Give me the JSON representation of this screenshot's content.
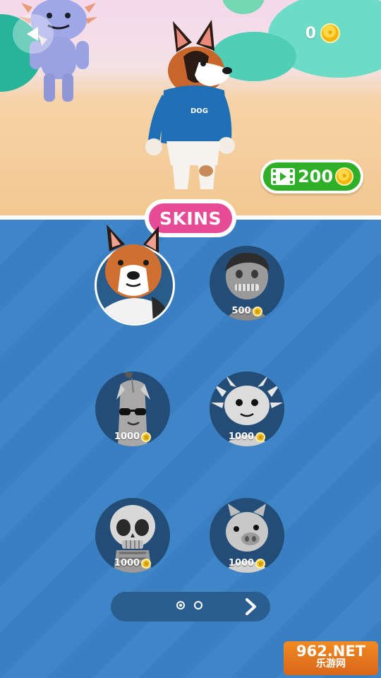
{
  "hud": {
    "coin_total": "0",
    "reward_amount": "200"
  },
  "panel": {
    "title": "SKINS"
  },
  "skins": [
    {
      "name": "dog",
      "price": null,
      "selected": true
    },
    {
      "name": "zombie-boy",
      "price": "500"
    },
    {
      "name": "banana",
      "price": "1000"
    },
    {
      "name": "axolotl",
      "price": "1000"
    },
    {
      "name": "skeleton",
      "price": "1000"
    },
    {
      "name": "pig",
      "price": "1000"
    }
  ],
  "pagination": {
    "pages": 2,
    "current": 1
  },
  "watermark": {
    "line1": "962.NET",
    "line2": "乐游网"
  },
  "colors": {
    "panel_blue": "#3f86c8",
    "skins_pink": "#e84b96",
    "reward_green": "#2fae28",
    "coin_gold": "#f2b50c"
  }
}
